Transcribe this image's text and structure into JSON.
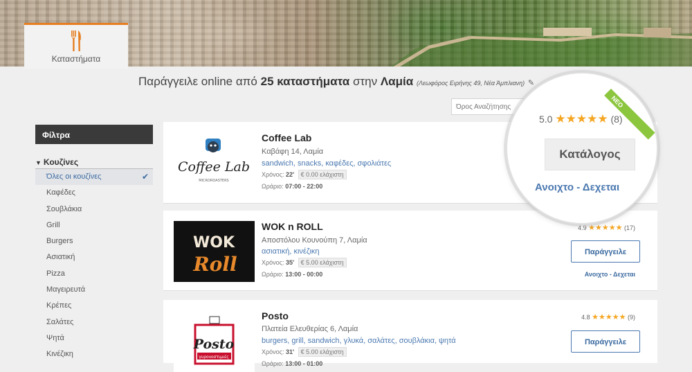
{
  "nav": {
    "stores_tab_label": "Καταστήματα",
    "stores_icon": "fork-knife-icon",
    "accent_color": "#e67e22"
  },
  "headline": {
    "prefix": "Παράγγειλε online από",
    "count_text": "25 καταστήματα",
    "middle": "στην",
    "city": "Λαμία",
    "address": "(Λεωφόρος Ειρήνης 49, Νέα Άμπλιανη)"
  },
  "search": {
    "placeholder": "Όρος Αναζήτησης"
  },
  "sidebar": {
    "filters_title": "Φίλτρα",
    "cuisines_title": "Κουζίνες",
    "items": [
      {
        "label": "Όλες οι κουζίνες",
        "selected": true
      },
      {
        "label": "Καφέδες"
      },
      {
        "label": "Σουβλάκια"
      },
      {
        "label": "Grill"
      },
      {
        "label": "Burgers"
      },
      {
        "label": "Ασιατική"
      },
      {
        "label": "Pizza"
      },
      {
        "label": "Μαγειρευτά"
      },
      {
        "label": "Κρέπες"
      },
      {
        "label": "Σαλάτες"
      },
      {
        "label": "Ψητά"
      },
      {
        "label": "Κινέζικη"
      }
    ]
  },
  "stores": [
    {
      "name": "Coffee Lab",
      "logo_text_1": "Coffee",
      "logo_text_2": "Lab",
      "logo_sub": "MICROROASTERS",
      "address": "Καβάφη 14, Λαμία",
      "tags": "sandwich, snacks, καφέδες, σφολιάτες",
      "time_label": "Χρόνος:",
      "time": "22'",
      "min_order": "€ 0.00 ελάχιστη",
      "hours_label": "Ωράριο:",
      "hours": "07:00 - 22:00",
      "rating": "5.0",
      "stars": "★★★★★",
      "reviews": "(8)",
      "catalog_label": "Κατάλογος",
      "status": "Ανοιχτο - Δεχεται",
      "ribbon": "NEO"
    },
    {
      "name": "WOK n ROLL",
      "logo_text_1": "WOK",
      "logo_text_2": "Roll",
      "address": "Αποστόλου Κουνούπη 7, Λαμία",
      "tags": "ασιατική, κινέζικη",
      "time_label": "Χρόνος:",
      "time": "35'",
      "min_order": "€ 5.00 ελάχιστη",
      "hours_label": "Ωράριο:",
      "hours": "13:00 - 00:00",
      "rating": "4.9",
      "stars": "★★★★★",
      "reviews": "(17)",
      "order_label": "Παράγγειλε",
      "status": "Ανοιχτο - Δεχεται"
    },
    {
      "name": "Posto",
      "logo_text_1": "Posto",
      "logo_sub": "γυρονοστιμιές",
      "address": "Πλατεία Ελευθερίας 6, Λαμία",
      "tags": "burgers, grill, sandwich, γλυκά, σαλάτες, σουβλάκια, ψητά",
      "time_label": "Χρόνος:",
      "time": "31'",
      "min_order": "€ 5.00 ελάχιστη",
      "hours_label": "Ωράριο:",
      "hours": "13:00 - 01:00",
      "rating": "4.8",
      "stars": "★★★★★",
      "reviews": "(9)",
      "order_label": "Παράγγειλε"
    }
  ]
}
